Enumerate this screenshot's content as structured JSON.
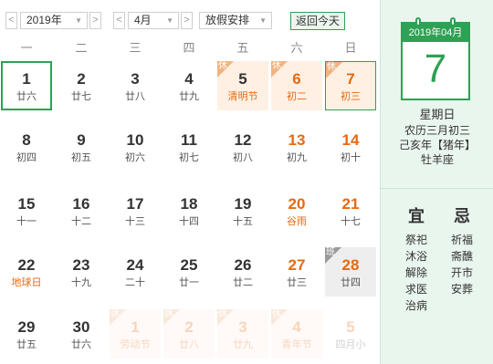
{
  "toolbar": {
    "prev_year": "<",
    "year": "2019年",
    "next_year": ">",
    "prev_month": "<",
    "month": "4月",
    "next_month": ">",
    "holiday": "放假安排",
    "today": "返回今天"
  },
  "weekdays": [
    "一",
    "二",
    "三",
    "四",
    "五",
    "六",
    "日"
  ],
  "days": [
    {
      "d": "1",
      "l": "廿六",
      "t": "today"
    },
    {
      "d": "2",
      "l": "廿七"
    },
    {
      "d": "3",
      "l": "廿八"
    },
    {
      "d": "4",
      "l": "廿九"
    },
    {
      "d": "5",
      "l": "清明节",
      "t": "holiday",
      "b": "休"
    },
    {
      "d": "6",
      "l": "初二",
      "t": "holiday",
      "b": "休",
      "w": true
    },
    {
      "d": "7",
      "l": "初三",
      "t": "holiday selected",
      "b": "休",
      "w": true
    },
    {
      "d": "8",
      "l": "初四"
    },
    {
      "d": "9",
      "l": "初五"
    },
    {
      "d": "10",
      "l": "初六"
    },
    {
      "d": "11",
      "l": "初七"
    },
    {
      "d": "12",
      "l": "初八"
    },
    {
      "d": "13",
      "l": "初九",
      "w": true
    },
    {
      "d": "14",
      "l": "初十",
      "w": true
    },
    {
      "d": "15",
      "l": "十一"
    },
    {
      "d": "16",
      "l": "十二"
    },
    {
      "d": "17",
      "l": "十三"
    },
    {
      "d": "18",
      "l": "十四"
    },
    {
      "d": "19",
      "l": "十五"
    },
    {
      "d": "20",
      "l": "谷雨",
      "w": true,
      "f": true
    },
    {
      "d": "21",
      "l": "十七",
      "w": true
    },
    {
      "d": "22",
      "l": "地球日",
      "f": true
    },
    {
      "d": "23",
      "l": "十九"
    },
    {
      "d": "24",
      "l": "二十"
    },
    {
      "d": "25",
      "l": "廿一"
    },
    {
      "d": "26",
      "l": "廿二"
    },
    {
      "d": "27",
      "l": "廿三",
      "w": true
    },
    {
      "d": "28",
      "l": "廿四",
      "t": "workday",
      "b": "班",
      "w": true
    },
    {
      "d": "29",
      "l": "廿五"
    },
    {
      "d": "30",
      "l": "廿六"
    },
    {
      "d": "1",
      "l": "劳动节",
      "t": "faded holiday",
      "b": "休"
    },
    {
      "d": "2",
      "l": "廿八",
      "t": "faded holiday",
      "b": "休"
    },
    {
      "d": "3",
      "l": "廿九",
      "t": "faded holiday",
      "b": "休"
    },
    {
      "d": "4",
      "l": "青年节",
      "t": "faded holiday",
      "b": "休"
    },
    {
      "d": "5",
      "l": "四月小",
      "t": "faded"
    }
  ],
  "panel": {
    "header": "2019年04月",
    "day": "7",
    "weekday": "星期日",
    "lunar": "农历三月初三",
    "ganzhi": "己亥年【猪年】",
    "zodiac": "牡羊座",
    "yi_title": "宜",
    "ji_title": "忌",
    "yi": [
      "祭祀",
      "沐浴",
      "解除",
      "求医",
      "治病"
    ],
    "ji": [
      "祈福",
      "斋醮",
      "开市",
      "安葬"
    ]
  },
  "colors": {
    "accent": "#2ea154",
    "weekend": "#e46a14",
    "holiday_bg": "#fff0e3"
  }
}
